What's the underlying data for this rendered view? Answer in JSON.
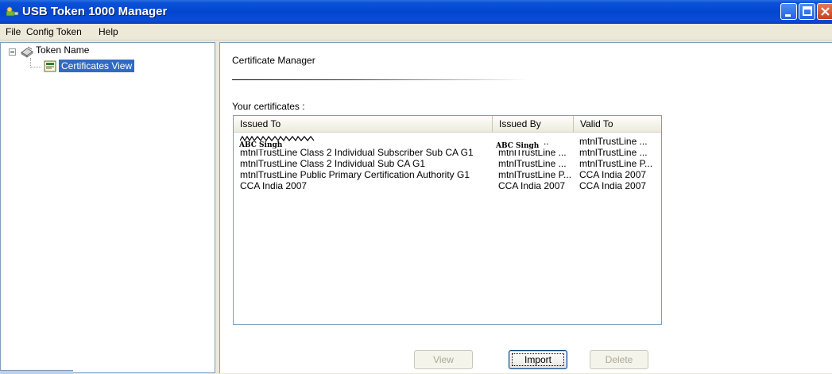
{
  "window": {
    "title": "USB Token 1000 Manager"
  },
  "menu": {
    "items": [
      "File",
      "Config Token",
      "Help"
    ]
  },
  "tree": {
    "root_label": "Token Name",
    "child_label": "Certificates View"
  },
  "content": {
    "title": "Certificate Manager",
    "certs_label": "Your certificates :",
    "columns": [
      "Issued To",
      "Issued By",
      "Valid To"
    ],
    "rows": [
      {
        "issued_to": "",
        "issued_by": "..",
        "valid_to": "mtnlTrustLine ..."
      },
      {
        "issued_to": "mtnlTrustLine Class 2 Individual Subscriber Sub CA G1",
        "issued_by": "mtnlTrustLine ...",
        "valid_to": "mtnlTrustLine ..."
      },
      {
        "issued_to": "mtnlTrustLine Class 2 Individual Sub CA G1",
        "issued_by": "mtnlTrustLine ...",
        "valid_to": "mtnlTrustLine P..."
      },
      {
        "issued_to": "mtnlTrustLine Public Primary Certification Authority G1",
        "issued_by": "mtnlTrustLine P...",
        "valid_to": "CCA India 2007"
      },
      {
        "issued_to": "CCA India 2007",
        "issued_by": "CCA India 2007",
        "valid_to": "CCA India 2007"
      }
    ],
    "signature_overlay": "ABC Singh"
  },
  "buttons": {
    "view": "View",
    "import": "Import",
    "delete": "Delete"
  },
  "colors": {
    "titlebar": "#0a52d9",
    "selection": "#316ac5",
    "window_bg": "#ece9d8"
  }
}
